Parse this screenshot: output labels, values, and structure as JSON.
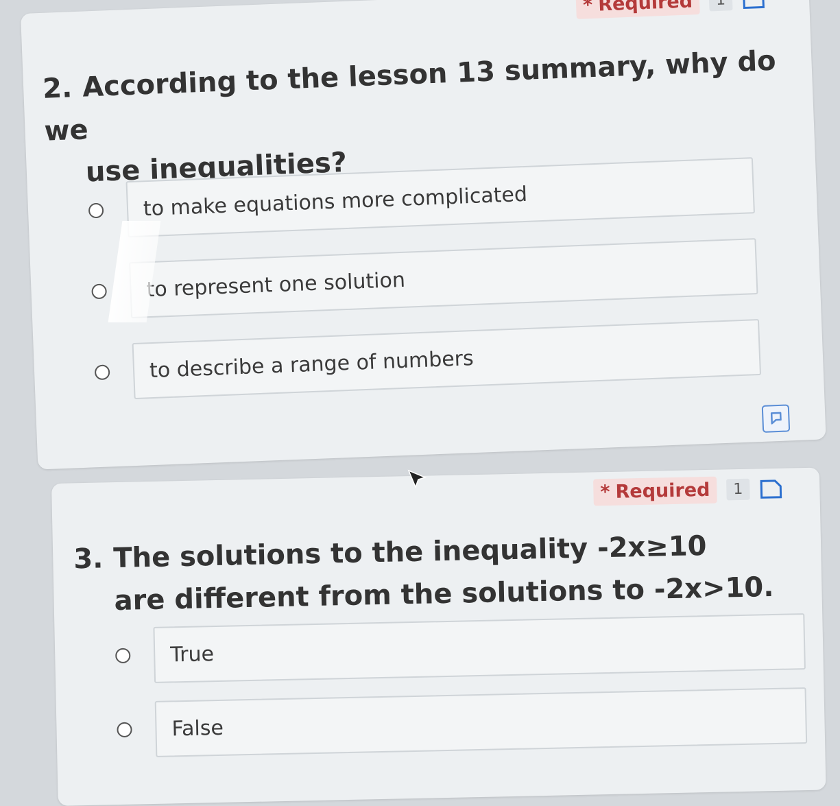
{
  "questions": [
    {
      "number": "2.",
      "required_label": "Required",
      "points": "1",
      "title_line1": "According to the lesson 13 summary, why do we",
      "title_line2": "use inequalities?",
      "options": [
        "to make equations more complicated",
        "to represent one solution",
        "to describe a range of numbers"
      ]
    },
    {
      "number": "3.",
      "required_label": "Required",
      "points": "1",
      "title_line1": "The solutions to the inequality -2x≥10",
      "title_line2": "are different from the solutions to -2x>10.",
      "options": [
        "True",
        "False"
      ]
    }
  ],
  "colors": {
    "required_text": "#b43a3a",
    "required_bg": "#f6dedd",
    "accent": "#5b8ed6"
  },
  "icons": {
    "bookmark": "bookmark-icon",
    "flag": "flag-icon",
    "asterisk": "asterisk-icon"
  }
}
